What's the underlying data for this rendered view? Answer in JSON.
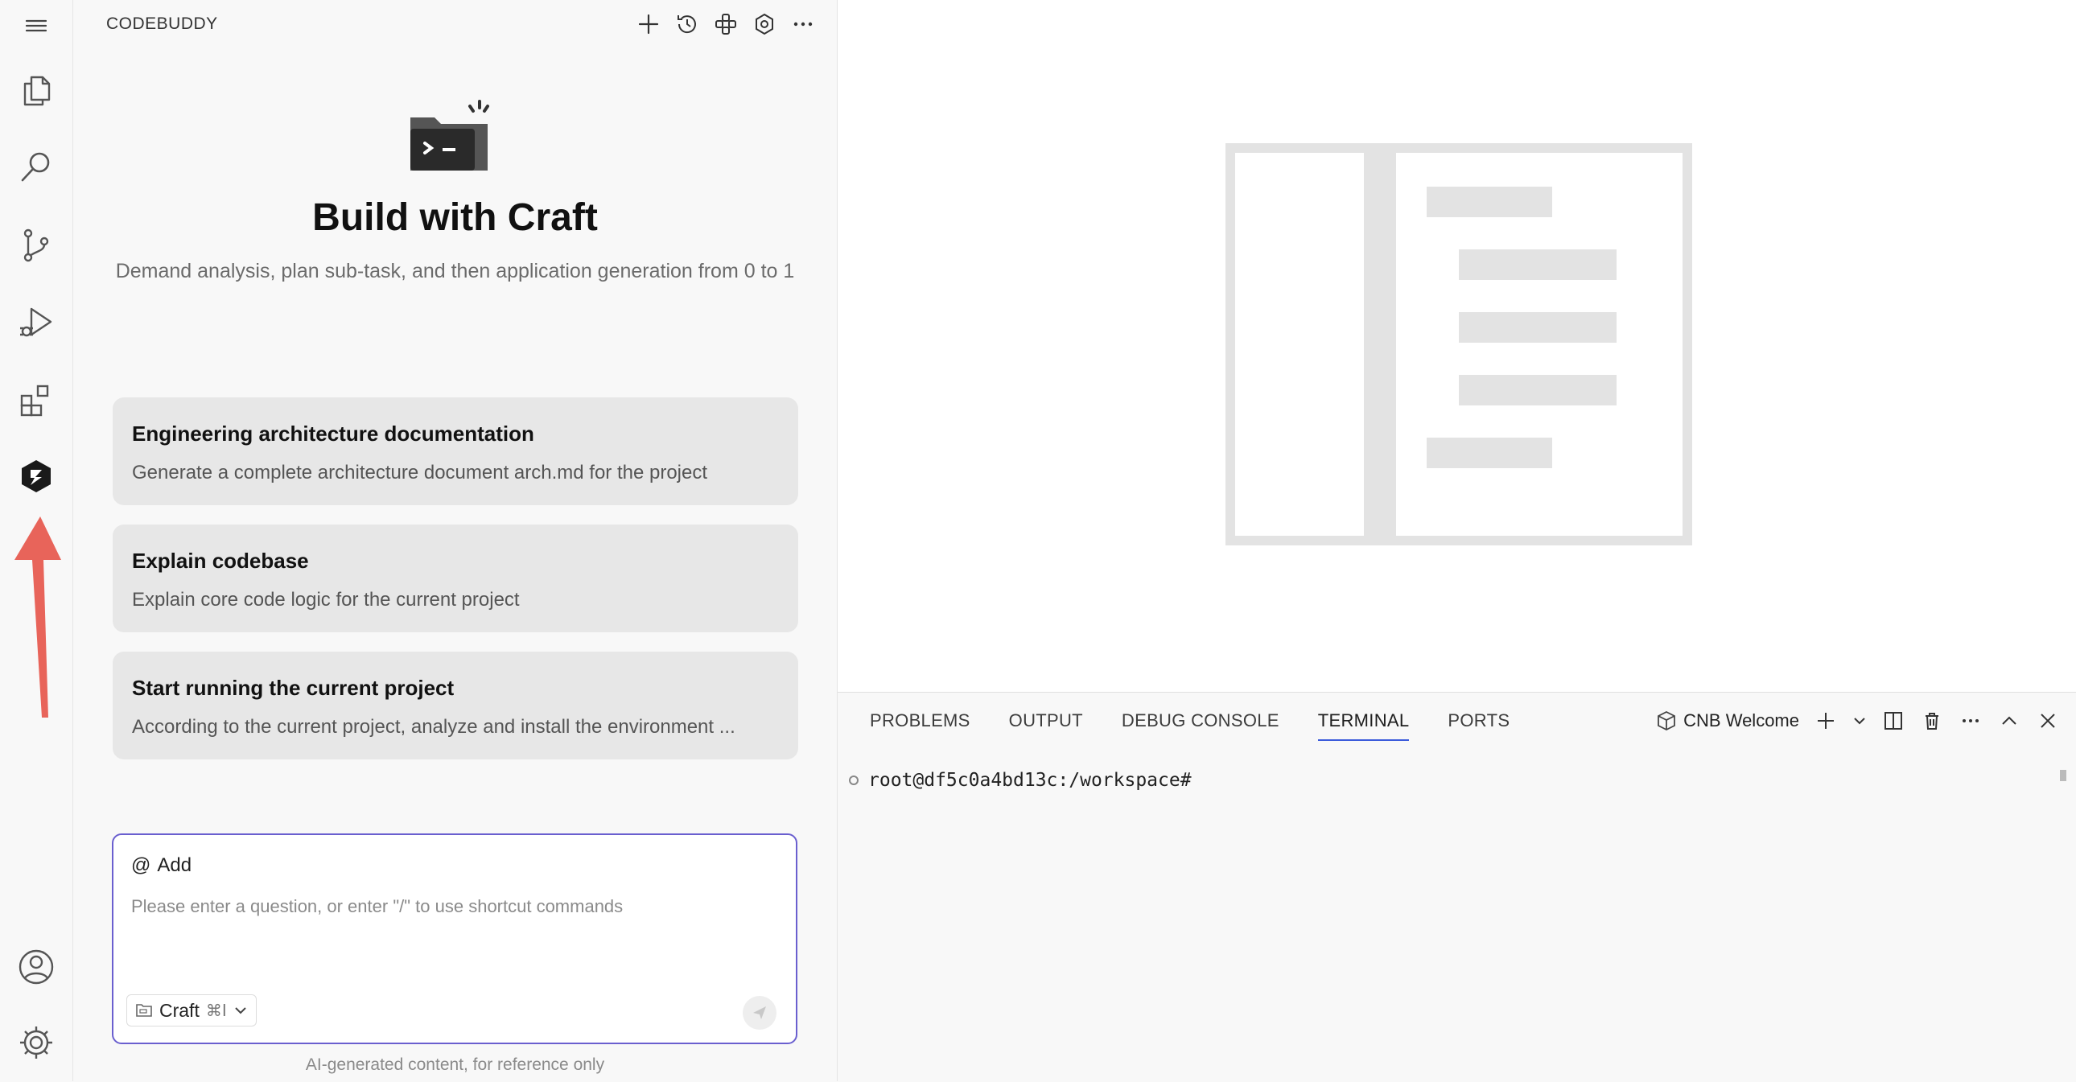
{
  "sidebar": {
    "title": "CODEBUDDY",
    "hero_title": "Build with Craft",
    "hero_subtitle": "Demand analysis, plan sub-task, and then application generation from 0 to 1",
    "cards": [
      {
        "title": "Engineering architecture documentation",
        "desc": "Generate a complete architecture document arch.md for the project"
      },
      {
        "title": "Explain codebase",
        "desc": "Explain core code logic for the current project"
      },
      {
        "title": "Start running the current project",
        "desc": "According to the current project, analyze and install the environment ..."
      }
    ],
    "chat": {
      "add_label": "Add",
      "placeholder": "Please enter a question, or enter \"/\" to use shortcut commands",
      "mode_label": "Craft",
      "mode_shortcut": "⌘I"
    },
    "ai_note": "AI-generated content, for reference only"
  },
  "panel": {
    "tabs": [
      {
        "label": "PROBLEMS"
      },
      {
        "label": "OUTPUT"
      },
      {
        "label": "DEBUG CONSOLE"
      },
      {
        "label": "TERMINAL",
        "active": true
      },
      {
        "label": "PORTS"
      }
    ],
    "terminal_name": "CNB Welcome",
    "terminal_prompt": "root@df5c0a4bd13c:/workspace#"
  },
  "colors": {
    "accent": "#6a5fcf",
    "arrow": "#e8645a",
    "tab_underline": "#3b5bdb"
  }
}
